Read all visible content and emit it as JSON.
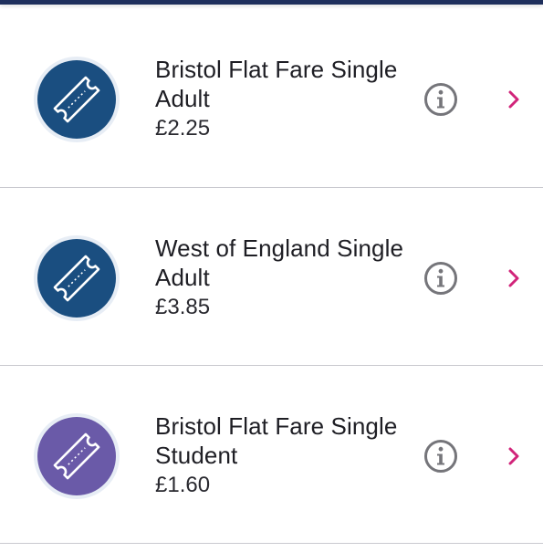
{
  "colors": {
    "header_bar": "#1e2f5c",
    "adult_badge": "#1a4e80",
    "student_badge": "#6a5aa8",
    "chevron": "#d1247a",
    "info_icon": "#75757a",
    "divider": "#c9c9cf"
  },
  "tickets": [
    {
      "title_line1": "Bristol Flat Fare Single",
      "title_line2": "Adult",
      "price": "£2.25",
      "badge_color": "#1a4e80",
      "icon": "ticket-icon"
    },
    {
      "title_line1": "West of England Single",
      "title_line2": "Adult",
      "price": "£3.85",
      "badge_color": "#1a4e80",
      "icon": "ticket-icon"
    },
    {
      "title_line1": "Bristol Flat Fare Single",
      "title_line2": "Student",
      "price": "£1.60",
      "badge_color": "#6a5aa8",
      "icon": "ticket-icon"
    }
  ]
}
